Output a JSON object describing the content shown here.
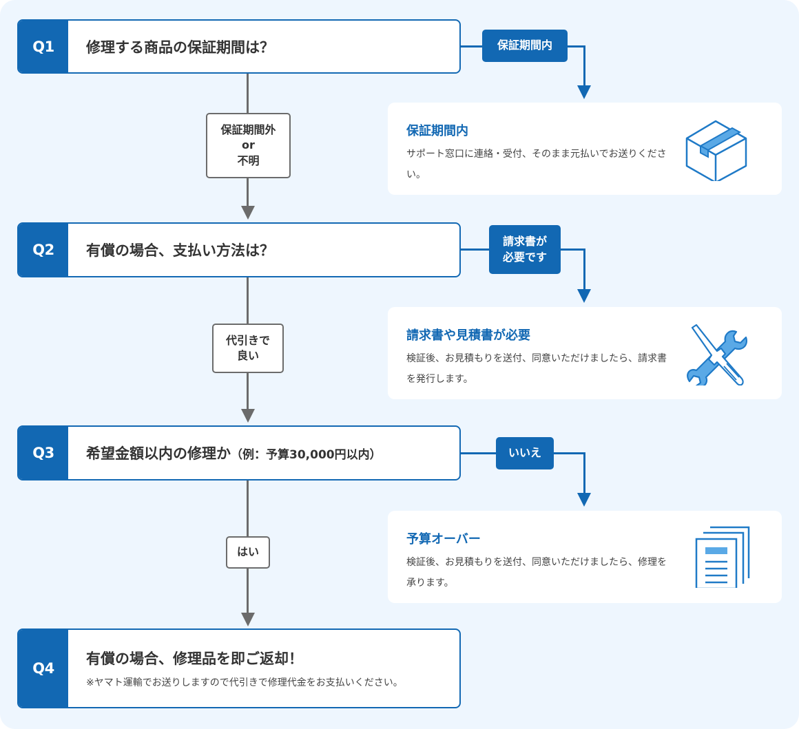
{
  "colors": {
    "primary": "#1268b3",
    "accent_light": "#5aa9e6",
    "connector_grey": "#6b6b6b",
    "background": "#eef6fe",
    "text": "#333333"
  },
  "questions": [
    {
      "num": "Q1",
      "text": "修理する商品の保証期間は？"
    },
    {
      "num": "Q2",
      "text": "有償の場合、支払い方法は？"
    },
    {
      "num": "Q3",
      "text": "希望金額以内の修理か",
      "text_small": "（例：予算30,000円以内）"
    },
    {
      "num": "Q4",
      "text": "有償の場合、修理品を即ご返却！",
      "note": "※ヤマト運輸でお送りしますので代引きで修理代金をお支払いください。"
    }
  ],
  "down_answers": [
    {
      "lines": [
        "保証期間外",
        "or",
        "不明"
      ]
    },
    {
      "lines": [
        "代引きで",
        "良い"
      ]
    },
    {
      "lines": [
        "はい"
      ]
    }
  ],
  "side_answers": [
    {
      "lines": [
        "保証期間内"
      ]
    },
    {
      "lines": [
        "請求書が",
        "必要です"
      ]
    },
    {
      "lines": [
        "いいえ"
      ]
    }
  ],
  "results": [
    {
      "title": "保証期間内",
      "desc": "サポート窓口に連絡・受付、そのまま元払いでお送りください。",
      "icon": "package-box-icon"
    },
    {
      "title": "請求書や見積書が必要",
      "desc": "検証後、お見積もりを送付、同意いただけましたら、請求書を発行します。",
      "icon": "wrench-screwdriver-icon"
    },
    {
      "title": "予算オーバー",
      "desc": "検証後、お見積もりを送付、同意いただけましたら、修理を承ります。",
      "icon": "documents-icon"
    }
  ]
}
